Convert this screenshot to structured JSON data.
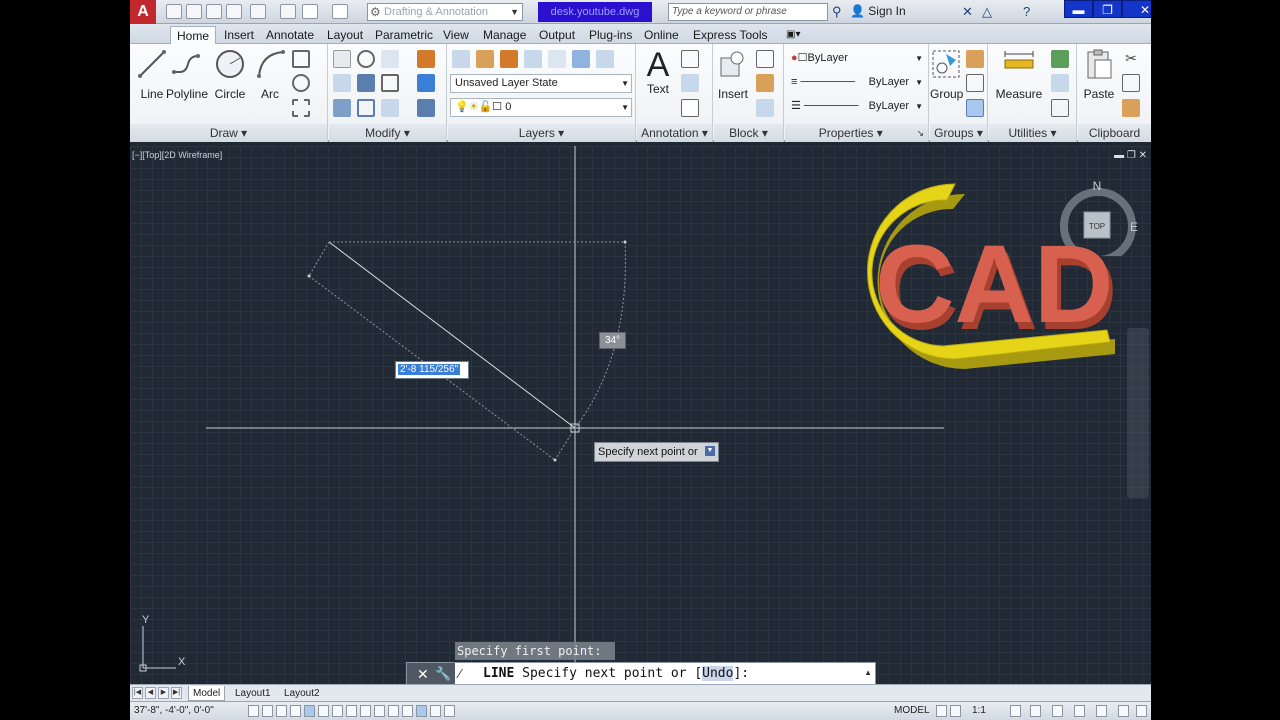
{
  "titlebar": {
    "app_letter": "A",
    "workspace": "Drafting & Annotation",
    "document_title": "desk.youtube.dwg",
    "search_placeholder": "Type a keyword or phrase",
    "sign_in": "Sign In"
  },
  "ribbon_tabs": [
    "Home",
    "Insert",
    "Annotate",
    "Layout",
    "Parametric",
    "View",
    "Manage",
    "Output",
    "Plug-ins",
    "Online",
    "Express Tools"
  ],
  "ribbon": {
    "draw": {
      "title": "Draw",
      "line": "Line",
      "polyline": "Polyline",
      "circle": "Circle",
      "arc": "Arc"
    },
    "modify": {
      "title": "Modify"
    },
    "layers": {
      "title": "Layers",
      "layer_state": "Unsaved Layer State",
      "current_layer": "0"
    },
    "annotation": {
      "title": "Annotation",
      "text": "Text"
    },
    "block": {
      "title": "Block",
      "insert": "Insert"
    },
    "properties": {
      "title": "Properties",
      "color": "ByLayer",
      "linetype": "ByLayer",
      "lineweight": "ByLayer"
    },
    "groups": {
      "title": "Groups",
      "group": "Group"
    },
    "utilities": {
      "title": "Utilities",
      "measure": "Measure"
    },
    "clipboard": {
      "title": "Clipboard",
      "paste": "Paste"
    }
  },
  "viewport": {
    "label": "[−][Top][2D Wireframe]",
    "length_input": "2'-8 115/256\"",
    "angle_input": "34°",
    "dynamic_prompt": "Specify next point or",
    "ucs_x": "X",
    "ucs_y": "Y",
    "viewcube": {
      "north": "N",
      "east": "E",
      "face": "TOP"
    },
    "watermark": "CAD"
  },
  "command": {
    "history": "Specify first point:",
    "cmd_name": "LINE",
    "prompt_start": "Specify next point or [",
    "option": "Undo",
    "prompt_end": "]:"
  },
  "layout_tabs": [
    "Model",
    "Layout1",
    "Layout2"
  ],
  "statusbar": {
    "coords": "37'-8\", -4'-0\", 0'-0\"",
    "space": "MODEL",
    "scale": "1:1"
  },
  "colors": {
    "ribbon_bg": "#f4f6f8",
    "drawing_bg": "#212a34",
    "accent": "#1436c8",
    "logo_yellow": "#e5d21a",
    "logo_red": "#d8604f"
  }
}
